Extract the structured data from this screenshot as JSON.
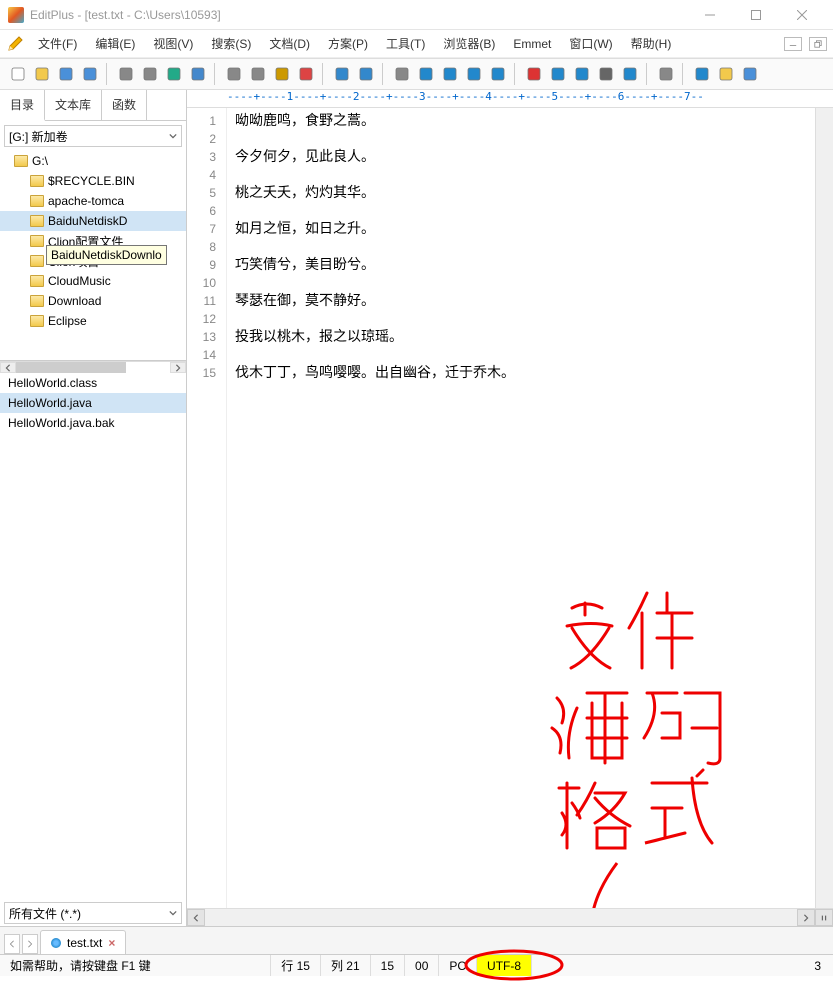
{
  "title": "EditPlus - [test.txt - C:\\Users\\10593]",
  "menu": [
    "文件(F)",
    "编辑(E)",
    "视图(V)",
    "搜索(S)",
    "文档(D)",
    "方案(P)",
    "工具(T)",
    "浏览器(B)",
    "Emmet",
    "窗口(W)",
    "帮助(H)"
  ],
  "toolbar_icons": [
    "new-file",
    "open-file",
    "save",
    "save-all",
    "print",
    "print-preview",
    "spell-check",
    "browser-preview",
    "cut",
    "copy",
    "paste",
    "delete",
    "undo",
    "redo",
    "find",
    "find-next",
    "find-prev",
    "replace",
    "goto-line",
    "font-small",
    "hex",
    "word-wrap",
    "ruler-toggle",
    "column-marker",
    "settings",
    "fullscreen",
    "panel-toggle",
    "panel2-toggle"
  ],
  "sidebar": {
    "tabs": [
      "目录",
      "文本库",
      "函数"
    ],
    "drive": "[G:] 新加卷",
    "tree": [
      {
        "label": "G:\\",
        "sel": false,
        "indent": false
      },
      {
        "label": "$RECYCLE.BIN",
        "sel": false,
        "indent": true
      },
      {
        "label": "apache-tomca",
        "sel": false,
        "indent": true
      },
      {
        "label": "BaiduNetdiskD",
        "sel": true,
        "indent": true
      },
      {
        "label": "Clion配置文件",
        "sel": false,
        "indent": true
      },
      {
        "label": "Clion项目",
        "sel": false,
        "indent": true
      },
      {
        "label": "CloudMusic",
        "sel": false,
        "indent": true
      },
      {
        "label": "Download",
        "sel": false,
        "indent": true
      },
      {
        "label": "Eclipse",
        "sel": false,
        "indent": true
      }
    ],
    "tooltip": "BaiduNetdiskDownlo",
    "files": [
      {
        "label": "HelloWorld.class",
        "sel": false
      },
      {
        "label": "HelloWorld.java",
        "sel": true
      },
      {
        "label": "HelloWorld.java.bak",
        "sel": false
      }
    ],
    "filter": "所有文件 (*.*)"
  },
  "ruler": "----+----1----+----2----+----3----+----4----+----5----+----6----+----7--",
  "editor": {
    "gutter": [
      "1",
      "2",
      "3",
      "4",
      "5",
      "6",
      "7",
      "8",
      "9",
      "10",
      "11",
      "12",
      "13",
      "14",
      "15"
    ],
    "lines": [
      "呦呦鹿鸣，食野之蒿。",
      "",
      "今夕何夕，见此良人。",
      "",
      "桃之夭夭，灼灼其华。",
      "",
      "如月之恒，如日之升。",
      "",
      "巧笑倩兮，美目盼兮。",
      "",
      "琴瑟在御，莫不静好。",
      "",
      "投我以桃木，报之以琼瑶。",
      "",
      "伐木丁丁，鸟鸣嘤嘤。出自幽谷，迁于乔木。"
    ]
  },
  "doctab": {
    "label": "test.txt"
  },
  "status": {
    "help": "如需帮助，请按键盘 F1 键",
    "row": "行 15",
    "col": "列 21",
    "sel": "15",
    "zeros": "00",
    "mode": "PC",
    "encoding": "UTF-8",
    "count": "3"
  },
  "annotation_label": "文件编码格式"
}
